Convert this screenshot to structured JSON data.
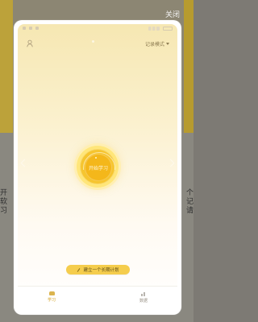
{
  "background_left_text": "开\n软\n习",
  "background_right_text": "个\n记\n请",
  "close_label": "关闭",
  "mode_select": {
    "label": "记录模式"
  },
  "focus_button": {
    "label": "开始学习"
  },
  "plan_button": {
    "label": "建立一个长期计划"
  },
  "bottom_nav": [
    {
      "label": "学习"
    },
    {
      "label": "数据"
    }
  ],
  "colors": {
    "accent": "#f4b71a",
    "nav_active": "#d2a122"
  }
}
